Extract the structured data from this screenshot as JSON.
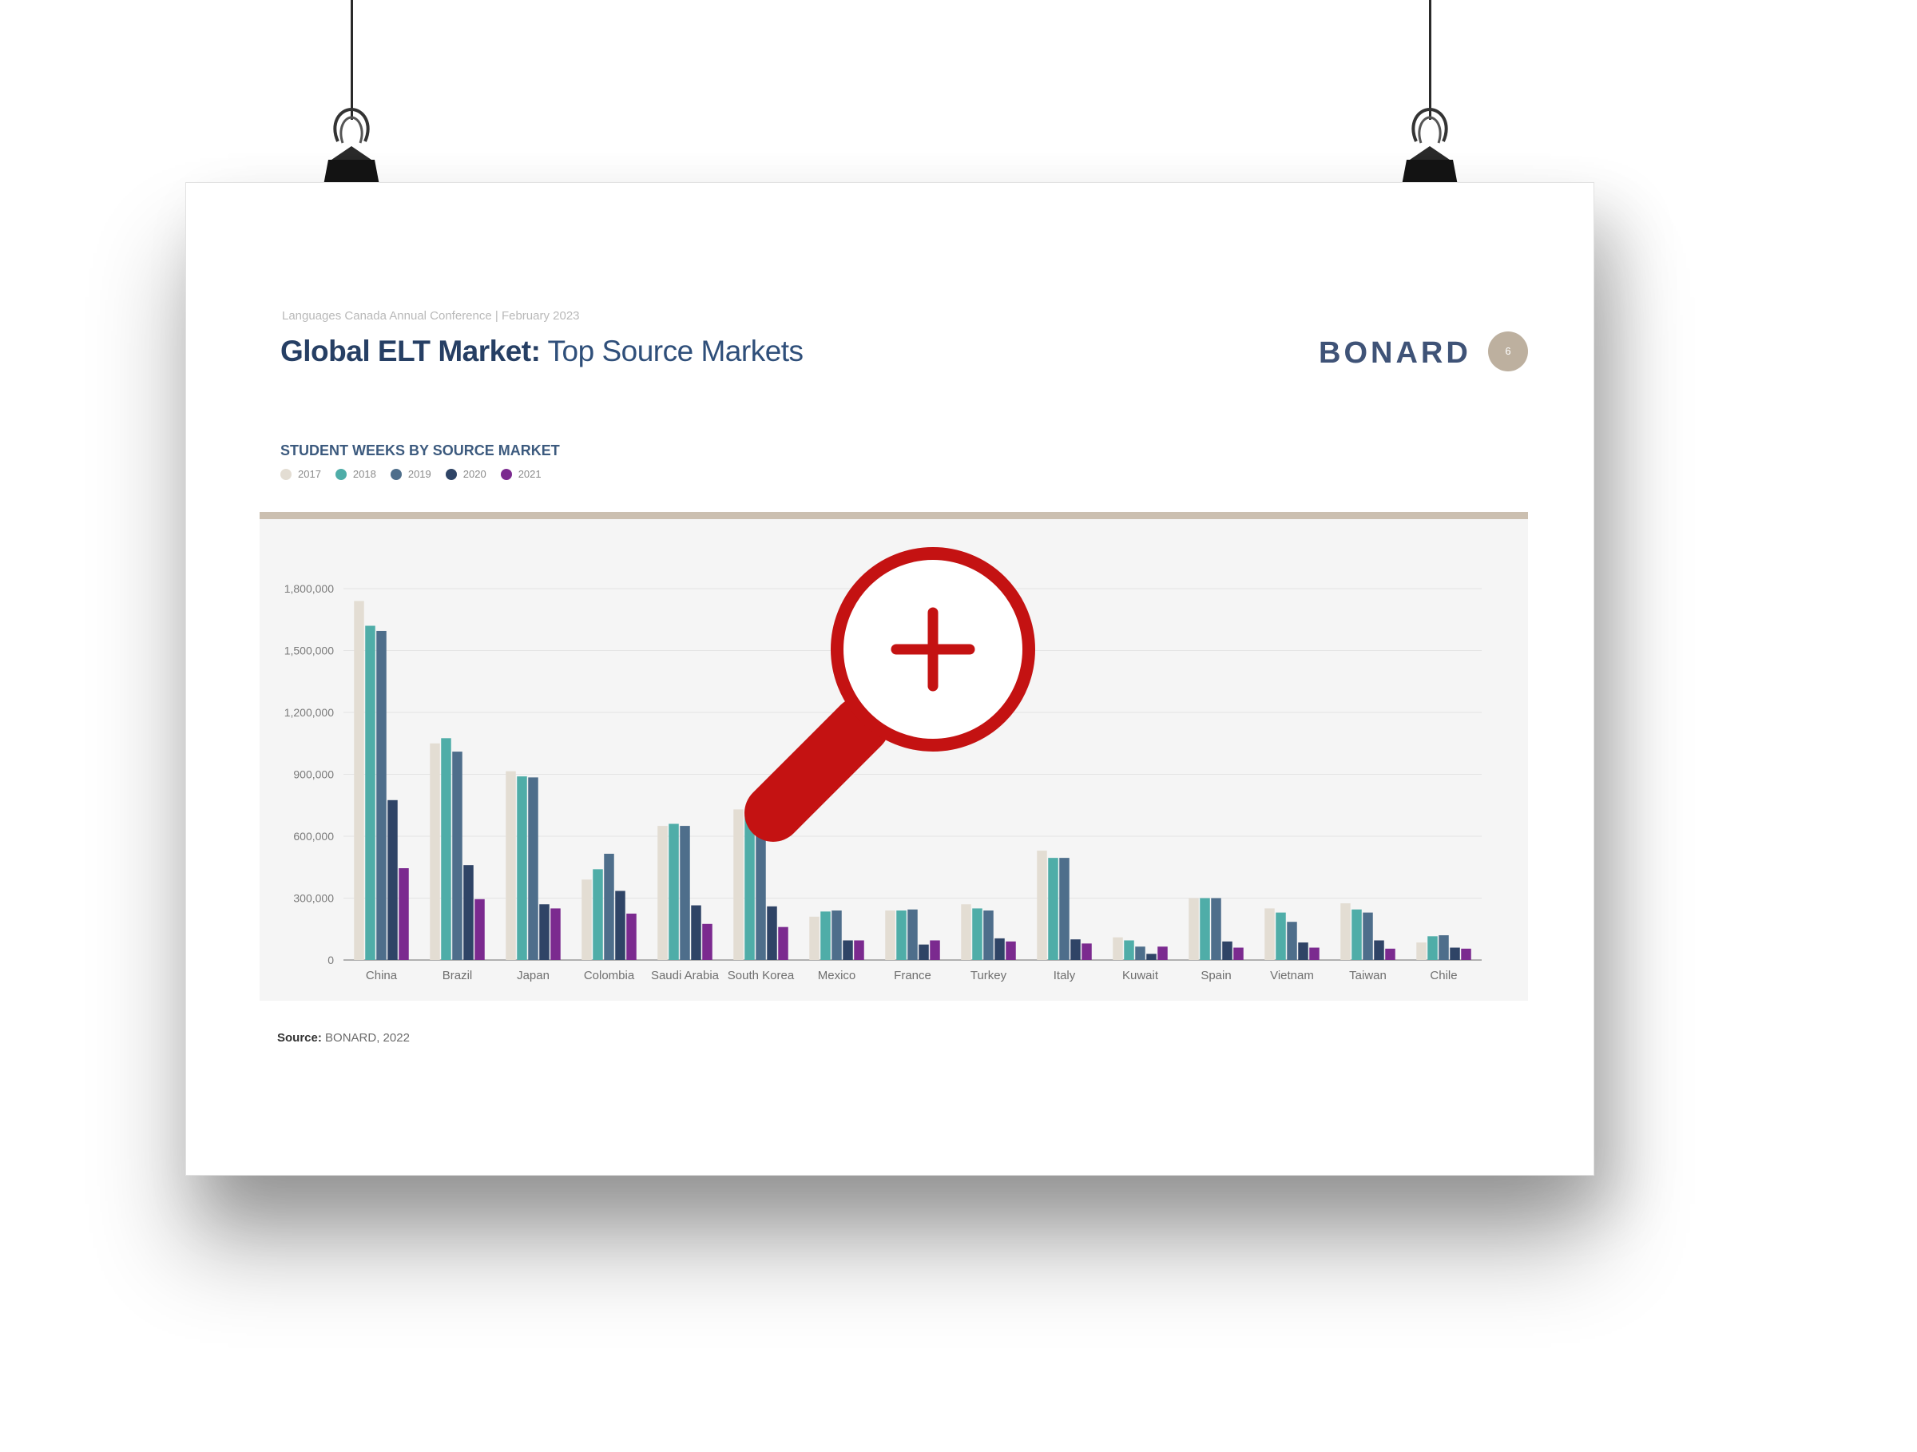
{
  "poster": {
    "meta": "Languages Canada Annual Conference  |  February 2023",
    "title_bold": "Global ELT Market:",
    "title_rest": " Top Source Markets",
    "brand": "BONARD",
    "page_number": "6",
    "chart_title": "STUDENT WEEKS BY SOURCE MARKET",
    "source_label": "Source:",
    "source_text": " BONARD, 2022"
  },
  "colors": {
    "accent_rule": "#cbbfb0",
    "magnifier": "#c41212"
  },
  "icons": {
    "zoom": "zoom-in-magnifier-icon",
    "clip": "binder-clip-icon"
  },
  "chart_data": {
    "type": "bar",
    "title": "STUDENT WEEKS BY SOURCE MARKET",
    "categories": [
      "China",
      "Brazil",
      "Japan",
      "Colombia",
      "Saudi Arabia",
      "South Korea",
      "Mexico",
      "France",
      "Turkey",
      "Italy",
      "Kuwait",
      "Spain",
      "Vietnam",
      "Taiwan",
      "Chile"
    ],
    "ylim": [
      0,
      1800000
    ],
    "yticks": [
      {
        "value": 0,
        "label": "0"
      },
      {
        "value": 300000,
        "label": "300,000"
      },
      {
        "value": 600000,
        "label": "600,000"
      },
      {
        "value": 900000,
        "label": "900,000"
      },
      {
        "value": 1200000,
        "label": "1,200,000"
      },
      {
        "value": 1500000,
        "label": "1,500,000"
      },
      {
        "value": 1800000,
        "label": "1,800,000"
      }
    ],
    "grid": true,
    "legend_position": "top-left",
    "series": [
      {
        "name": "2017",
        "color": "#e3ddd3",
        "values": [
          1740000,
          1050000,
          915000,
          390000,
          650000,
          730000,
          210000,
          240000,
          270000,
          530000,
          110000,
          300000,
          250000,
          275000,
          85000
        ]
      },
      {
        "name": "2018",
        "color": "#4fada8",
        "values": [
          1620000,
          1075000,
          890000,
          440000,
          660000,
          720000,
          235000,
          240000,
          250000,
          495000,
          95000,
          300000,
          230000,
          245000,
          115000
        ]
      },
      {
        "name": "2019",
        "color": "#4e6e8b",
        "values": [
          1595000,
          1010000,
          885000,
          515000,
          650000,
          700000,
          240000,
          245000,
          240000,
          495000,
          65000,
          300000,
          185000,
          230000,
          120000
        ]
      },
      {
        "name": "2020",
        "color": "#2f4466",
        "values": [
          775000,
          460000,
          270000,
          335000,
          265000,
          260000,
          95000,
          75000,
          105000,
          100000,
          30000,
          90000,
          85000,
          95000,
          60000
        ]
      },
      {
        "name": "2021",
        "color": "#7b2a8f",
        "values": [
          445000,
          295000,
          250000,
          225000,
          175000,
          160000,
          95000,
          95000,
          90000,
          80000,
          65000,
          60000,
          60000,
          55000,
          55000
        ]
      }
    ]
  }
}
